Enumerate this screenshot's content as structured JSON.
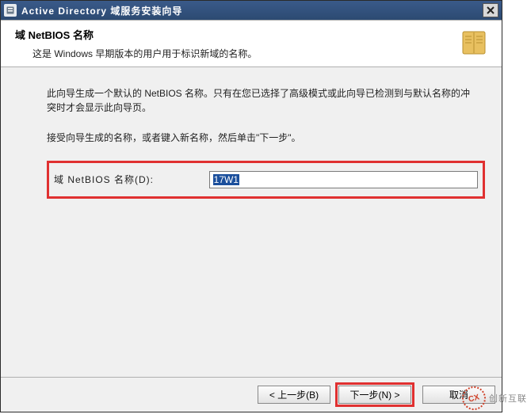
{
  "window": {
    "title": "Active Directory 域服务安装向导"
  },
  "header": {
    "title": "域 NetBIOS 名称",
    "desc": "这是 Windows 早期版本的用户用于标识新域的名称。"
  },
  "content": {
    "para1": "此向导生成一个默认的 NetBIOS 名称。只有在您已选择了高级模式或此向导已检测到与默认名称的冲突时才会显示此向导页。",
    "para2": "接受向导生成的名称，或者键入新名称，然后单击\"下一步\"。",
    "field_label": "域 NetBIOS 名称(D):",
    "field_value": "17W1"
  },
  "buttons": {
    "back": "< 上一步(B)",
    "next": "下一步(N) >",
    "cancel": "取消"
  },
  "watermark": {
    "text": "创新互联"
  }
}
